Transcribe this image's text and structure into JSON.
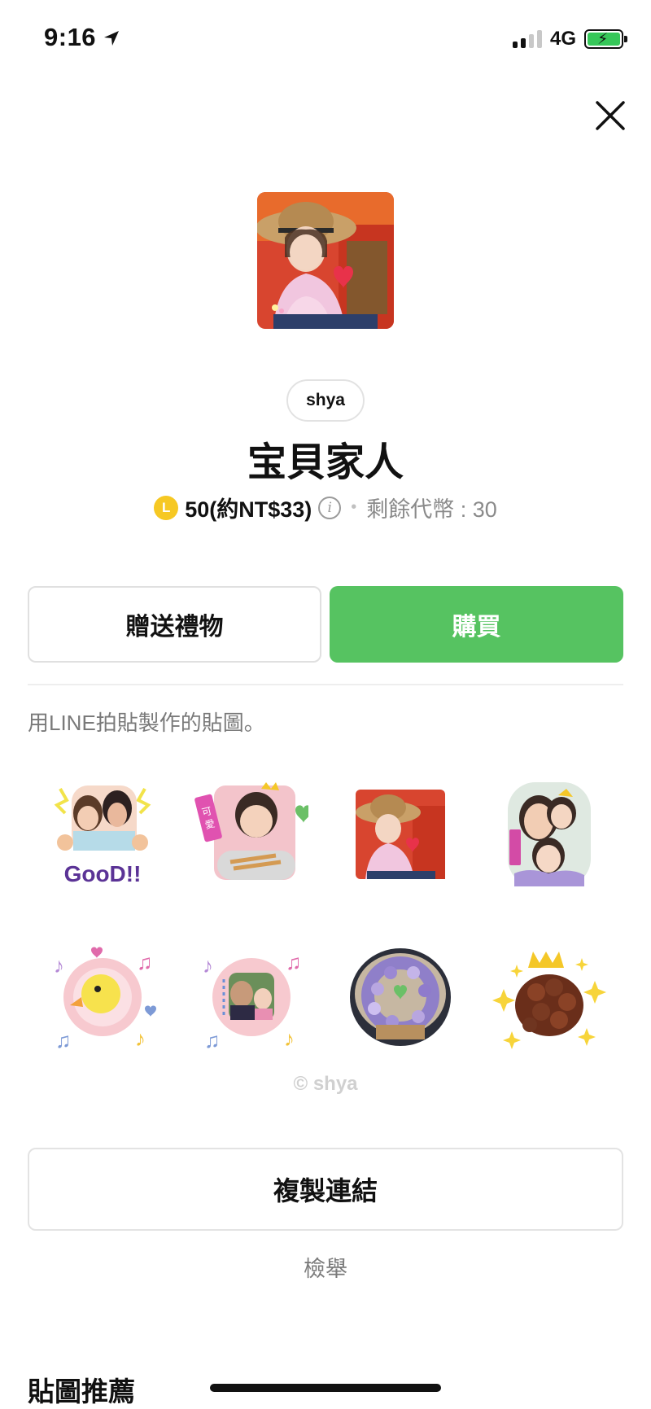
{
  "status_bar": {
    "time": "9:16",
    "network": "4G",
    "battery_color": "#36c759"
  },
  "sticker_pack": {
    "author": "shya",
    "title": "宝貝家人",
    "coin_icon": "L",
    "price": "50(約NT$33)",
    "separator": "•",
    "coins_left": "剩餘代幣 : 30",
    "description": "用LINE拍貼製作的貼圖。",
    "copyright": "© shya",
    "accent_color": "#56c361"
  },
  "actions": {
    "gift_label": "贈送禮物",
    "buy_label": "購買",
    "copy_link_label": "複製連結",
    "report_label": "檢舉"
  },
  "sticker_previews": [
    {
      "icon": "photo-sticker-good-icon",
      "caption": "GooD!!"
    },
    {
      "icon": "photo-sticker-child-snack-icon",
      "caption": "可愛"
    },
    {
      "icon": "photo-sticker-girl-hat-icon",
      "caption": ""
    },
    {
      "icon": "photo-sticker-family-icon",
      "caption": ""
    },
    {
      "icon": "chick-music-icon",
      "caption": ""
    },
    {
      "icon": "photo-frame-music-icon",
      "caption": ""
    },
    {
      "icon": "flower-wreath-icon",
      "caption": ""
    },
    {
      "icon": "chocolate-crown-sparkle-icon",
      "caption": ""
    }
  ],
  "recommendations": {
    "title": "貼圖推薦"
  }
}
